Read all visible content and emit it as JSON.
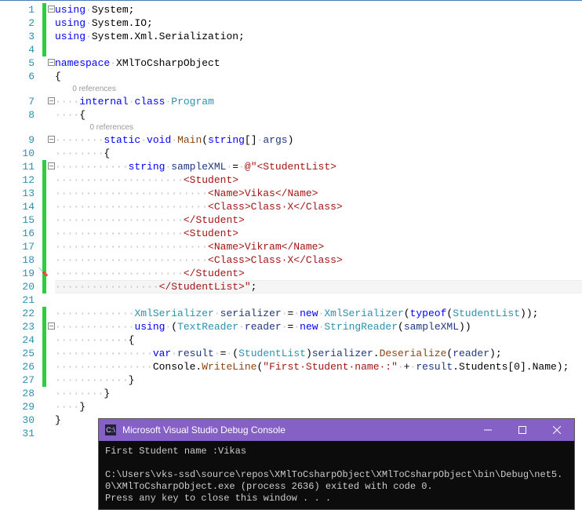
{
  "lineCount": 31,
  "codelens": {
    "program": "0 references",
    "main": "0 references"
  },
  "code": {
    "l1": {
      "pre": "",
      "seg": [
        {
          "c": "kw",
          "t": "using"
        },
        {
          "c": "dots",
          "t": "·"
        },
        {
          "c": "txt",
          "t": "System;"
        }
      ]
    },
    "l2": {
      "pre": "",
      "seg": [
        {
          "c": "kw",
          "t": "using"
        },
        {
          "c": "dots",
          "t": "·"
        },
        {
          "c": "txt",
          "t": "System.IO;"
        }
      ]
    },
    "l3": {
      "pre": "",
      "seg": [
        {
          "c": "kw",
          "t": "using"
        },
        {
          "c": "dots",
          "t": "·"
        },
        {
          "c": "txt",
          "t": "System.Xml.Serialization;"
        }
      ]
    },
    "l4": {
      "pre": "",
      "seg": []
    },
    "l5": {
      "pre": "",
      "seg": [
        {
          "c": "kw",
          "t": "namespace"
        },
        {
          "c": "dots",
          "t": "·"
        },
        {
          "c": "txt",
          "t": "XMlToCsharpObject"
        }
      ]
    },
    "l6": {
      "pre": "",
      "seg": [
        {
          "c": "txt",
          "t": "{"
        }
      ]
    },
    "l7": {
      "pre": "····",
      "seg": [
        {
          "c": "kw",
          "t": "internal"
        },
        {
          "c": "dots",
          "t": "·"
        },
        {
          "c": "kw",
          "t": "class"
        },
        {
          "c": "dots",
          "t": "·"
        },
        {
          "c": "type",
          "t": "Program"
        }
      ]
    },
    "l8": {
      "pre": "····",
      "seg": [
        {
          "c": "txt",
          "t": "{"
        }
      ]
    },
    "l9": {
      "pre": "········",
      "seg": [
        {
          "c": "kw",
          "t": "static"
        },
        {
          "c": "dots",
          "t": "·"
        },
        {
          "c": "kw",
          "t": "void"
        },
        {
          "c": "dots",
          "t": "·"
        },
        {
          "c": "mem",
          "t": "Main"
        },
        {
          "c": "txt",
          "t": "("
        },
        {
          "c": "kw",
          "t": "string"
        },
        {
          "c": "txt",
          "t": "[]"
        },
        {
          "c": "dots",
          "t": "·"
        },
        {
          "c": "var",
          "t": "args"
        },
        {
          "c": "txt",
          "t": ")"
        }
      ]
    },
    "l10": {
      "pre": "········",
      "seg": [
        {
          "c": "txt",
          "t": "{"
        }
      ]
    },
    "l11": {
      "pre": "············",
      "seg": [
        {
          "c": "kw",
          "t": "string"
        },
        {
          "c": "dots",
          "t": "·"
        },
        {
          "c": "var",
          "t": "sampleXML"
        },
        {
          "c": "dots",
          "t": "·"
        },
        {
          "c": "txt",
          "t": "="
        },
        {
          "c": "dots",
          "t": "·"
        },
        {
          "c": "str",
          "t": "@\"<StudentList>"
        }
      ]
    },
    "l12": {
      "pre": "····················",
      "seg": [
        {
          "c": "dots",
          "t": "·"
        },
        {
          "c": "str",
          "t": "<Student>"
        }
      ]
    },
    "l13": {
      "pre": "························",
      "seg": [
        {
          "c": "dots",
          "t": "·"
        },
        {
          "c": "str",
          "t": "<Name>Vikas</Name>"
        }
      ]
    },
    "l14": {
      "pre": "························",
      "seg": [
        {
          "c": "dots",
          "t": "·"
        },
        {
          "c": "str",
          "t": "<Class>Class·X</Class>"
        }
      ]
    },
    "l15": {
      "pre": "····················",
      "seg": [
        {
          "c": "dots",
          "t": "·"
        },
        {
          "c": "str",
          "t": "</Student>"
        }
      ]
    },
    "l16": {
      "pre": "····················",
      "seg": [
        {
          "c": "dots",
          "t": "·"
        },
        {
          "c": "str",
          "t": "<Student>"
        }
      ]
    },
    "l17": {
      "pre": "························",
      "seg": [
        {
          "c": "dots",
          "t": "·"
        },
        {
          "c": "str",
          "t": "<Name>Vikram</Name>"
        }
      ]
    },
    "l18": {
      "pre": "························",
      "seg": [
        {
          "c": "dots",
          "t": "·"
        },
        {
          "c": "str",
          "t": "<Class>Class·X</Class>"
        }
      ]
    },
    "l19": {
      "pre": "····················",
      "seg": [
        {
          "c": "dots",
          "t": "·"
        },
        {
          "c": "str",
          "t": "</Student>"
        }
      ]
    },
    "l20": {
      "pre": "················",
      "seg": [
        {
          "c": "dots",
          "t": "·"
        },
        {
          "c": "str",
          "t": "</StudentList>\""
        },
        {
          "c": "txt",
          "t": ";"
        }
      ]
    },
    "l21": {
      "pre": "",
      "seg": []
    },
    "l22": {
      "pre": "············",
      "seg": [
        {
          "c": "dots",
          "t": "·"
        },
        {
          "c": "type",
          "t": "XmlSerializer"
        },
        {
          "c": "dots",
          "t": "·"
        },
        {
          "c": "var",
          "t": "serializer"
        },
        {
          "c": "dots",
          "t": "·"
        },
        {
          "c": "txt",
          "t": "="
        },
        {
          "c": "dots",
          "t": "·"
        },
        {
          "c": "kw",
          "t": "new"
        },
        {
          "c": "dots",
          "t": "·"
        },
        {
          "c": "type",
          "t": "XmlSerializer"
        },
        {
          "c": "txt",
          "t": "("
        },
        {
          "c": "kw",
          "t": "typeof"
        },
        {
          "c": "txt",
          "t": "("
        },
        {
          "c": "type",
          "t": "StudentList"
        },
        {
          "c": "txt",
          "t": "));"
        }
      ]
    },
    "l23": {
      "pre": "············",
      "seg": [
        {
          "c": "dots",
          "t": "·"
        },
        {
          "c": "kw",
          "t": "using"
        },
        {
          "c": "dots",
          "t": "·"
        },
        {
          "c": "txt",
          "t": "("
        },
        {
          "c": "type",
          "t": "TextReader"
        },
        {
          "c": "dots",
          "t": "·"
        },
        {
          "c": "var",
          "t": "reader"
        },
        {
          "c": "dots",
          "t": "·"
        },
        {
          "c": "txt",
          "t": "="
        },
        {
          "c": "dots",
          "t": "·"
        },
        {
          "c": "kw",
          "t": "new"
        },
        {
          "c": "dots",
          "t": "·"
        },
        {
          "c": "type",
          "t": "StringReader"
        },
        {
          "c": "txt",
          "t": "("
        },
        {
          "c": "var",
          "t": "sampleXML"
        },
        {
          "c": "txt",
          "t": "))"
        }
      ]
    },
    "l24": {
      "pre": "············",
      "seg": [
        {
          "c": "txt",
          "t": "{"
        }
      ]
    },
    "l25": {
      "pre": "················",
      "seg": [
        {
          "c": "kw",
          "t": "var"
        },
        {
          "c": "dots",
          "t": "·"
        },
        {
          "c": "var",
          "t": "result"
        },
        {
          "c": "dots",
          "t": "·"
        },
        {
          "c": "txt",
          "t": "="
        },
        {
          "c": "dots",
          "t": "·"
        },
        {
          "c": "txt",
          "t": "("
        },
        {
          "c": "type",
          "t": "StudentList"
        },
        {
          "c": "txt",
          "t": ")"
        },
        {
          "c": "var",
          "t": "serializer"
        },
        {
          "c": "txt",
          "t": "."
        },
        {
          "c": "mem",
          "t": "Deserialize"
        },
        {
          "c": "txt",
          "t": "("
        },
        {
          "c": "var",
          "t": "reader"
        },
        {
          "c": "txt",
          "t": ");"
        }
      ]
    },
    "l26": {
      "pre": "················",
      "seg": [
        {
          "c": "txt",
          "t": "Console."
        },
        {
          "c": "mem",
          "t": "WriteLine"
        },
        {
          "c": "txt",
          "t": "("
        },
        {
          "c": "str",
          "t": "\"First·Student·name·:\""
        },
        {
          "c": "dots",
          "t": "·"
        },
        {
          "c": "txt",
          "t": "+"
        },
        {
          "c": "dots",
          "t": "·"
        },
        {
          "c": "var",
          "t": "result"
        },
        {
          "c": "txt",
          "t": ".Students[0].Name);"
        }
      ]
    },
    "l27": {
      "pre": "············",
      "seg": [
        {
          "c": "txt",
          "t": "}"
        }
      ]
    },
    "l28": {
      "pre": "········",
      "seg": [
        {
          "c": "txt",
          "t": "}"
        }
      ]
    },
    "l29": {
      "pre": "····",
      "seg": [
        {
          "c": "txt",
          "t": "}"
        }
      ]
    },
    "l30": {
      "pre": "",
      "seg": [
        {
          "c": "txt",
          "t": "}"
        }
      ]
    },
    "l31": {
      "pre": "",
      "seg": []
    }
  },
  "console": {
    "title": "Microsoft Visual Studio Debug Console",
    "output": "First Student name :Vikas\n\nC:\\Users\\vks-ssd\\source\\repos\\XMlToCsharpObject\\XMlToCsharpObject\\bin\\Debug\\net5.0\\XMlToCsharpObject.exe (process 2636) exited with code 0.\nPress any key to close this window . . ."
  }
}
